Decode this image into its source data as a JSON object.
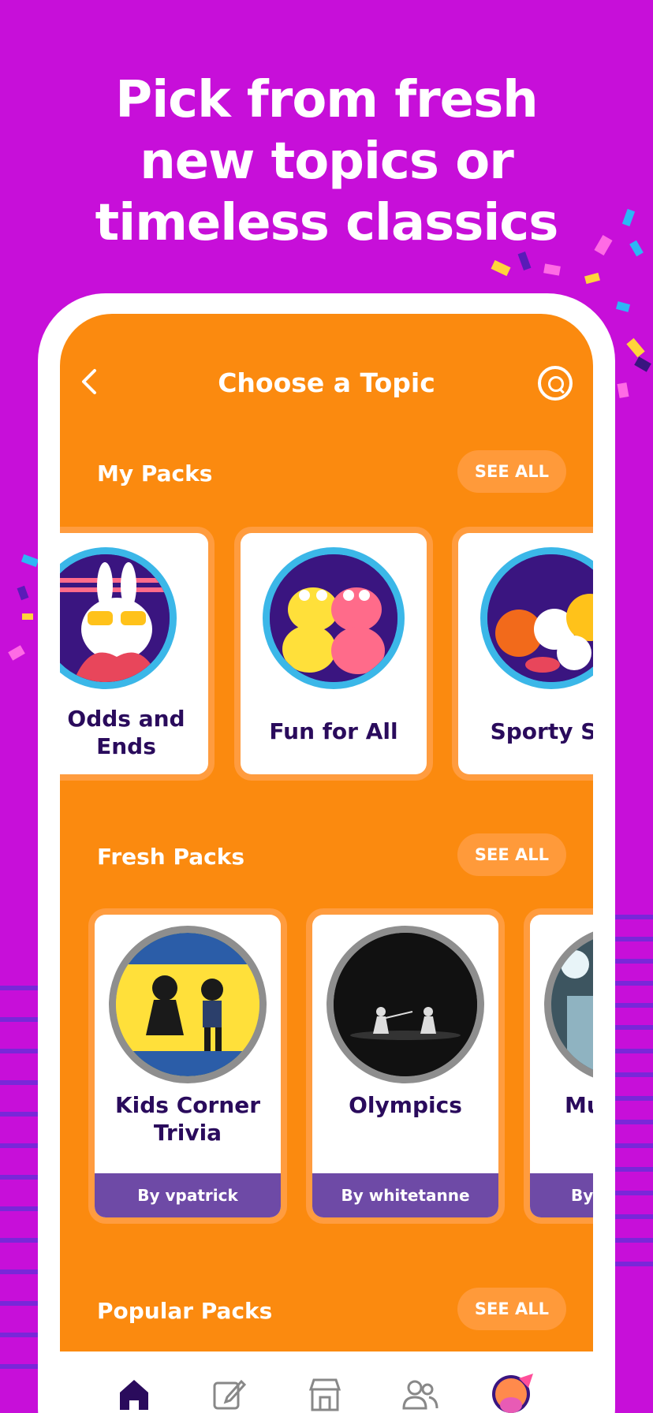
{
  "headline": {
    "line1": "Pick from fresh",
    "line2": "new topics or",
    "line3": "timeless classics"
  },
  "nav": {
    "title": "Choose a Topic",
    "back_icon": "chevron-left-icon",
    "search_icon": "search-icon"
  },
  "sections": {
    "my_packs": {
      "title": "My Packs",
      "see_all": "SEE ALL",
      "items": [
        {
          "label_line1": "Odds and",
          "label_line2": "Ends",
          "art": "bunny-art"
        },
        {
          "label": "Fun for All",
          "art": "frogs-art"
        },
        {
          "label": "Sporty Sp",
          "art": "sports-balls-art"
        }
      ]
    },
    "fresh_packs": {
      "title": "Fresh Packs",
      "see_all": "SEE ALL",
      "items": [
        {
          "label_line1": "Kids Corner",
          "label_line2": "Trivia",
          "author": "By vpatrick",
          "art": "kids-dancing-art"
        },
        {
          "label": "Olympics",
          "author": "By whitetanne",
          "art": "fencing-art"
        },
        {
          "label": "Mu",
          "author": "By",
          "art": "concert-art"
        }
      ]
    },
    "popular_packs": {
      "title": "Popular Packs",
      "see_all": "SEE ALL"
    }
  },
  "tabbar": {
    "items": [
      "home-icon",
      "edit-icon",
      "store-icon",
      "friends-icon",
      "profile-avatar"
    ]
  },
  "colors": {
    "background": "#C70FD9",
    "screen": "#FB8A0F",
    "title_text": "#2A0B5C",
    "author_bar": "#6E4AA6",
    "ring": "#3BB7E8"
  }
}
